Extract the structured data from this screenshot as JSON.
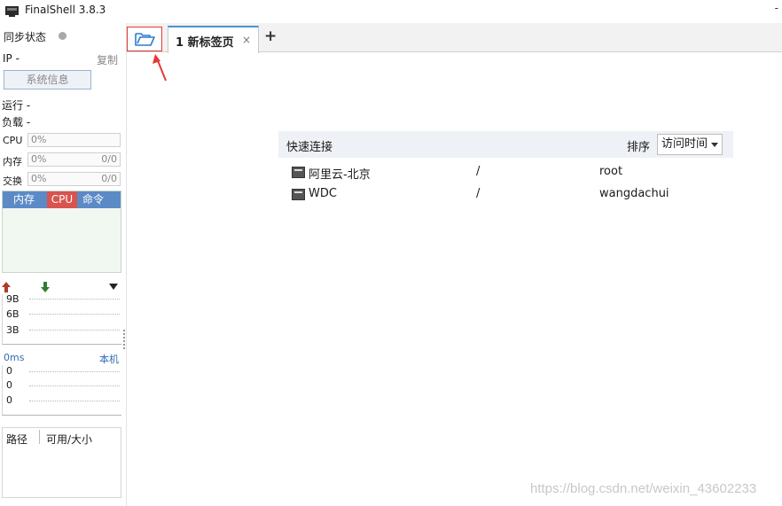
{
  "window": {
    "title": "FinalShell 3.8.3",
    "control": "-"
  },
  "left_panel": {
    "sync_label": "同步状态",
    "ip_label": "IP  -",
    "copy_label": "复制",
    "sysinfo_button": "系统信息",
    "run_label": "运行 -",
    "load_label": "负载 -",
    "meters": [
      {
        "label": "CPU",
        "value": "0%",
        "extra": ""
      },
      {
        "label": "内存",
        "value": "0%",
        "extra": "0/0"
      },
      {
        "label": "交换",
        "value": "0%",
        "extra": "0/0"
      }
    ],
    "process_tabs": [
      "内存",
      "CPU",
      "命令"
    ],
    "net_graph": {
      "rows": [
        "9B",
        "6B",
        "3B"
      ]
    },
    "ping": {
      "latency": "0ms",
      "host": "本机",
      "rows": [
        "0",
        "0",
        "0"
      ]
    },
    "disk": {
      "col_path": "路径",
      "col_avail": "可用/大小"
    }
  },
  "tabbar": {
    "tabs": [
      {
        "label": "1 新标签页",
        "close": "×"
      }
    ],
    "add": "+"
  },
  "quick_connect": {
    "title": "快速连接",
    "sort_label": "排序",
    "sort_value": "访问时间",
    "connections": [
      {
        "name": "阿里云-北京",
        "path": "/",
        "user": "root"
      },
      {
        "name": "WDC",
        "path": "/",
        "user": "wangdachui"
      }
    ]
  },
  "watermark": "https://blog.csdn.net/weixin_43602233",
  "colors": {
    "accent": "#4a90d9",
    "highlight_box": "#e53935",
    "cpu_tab": "#d9534f"
  }
}
